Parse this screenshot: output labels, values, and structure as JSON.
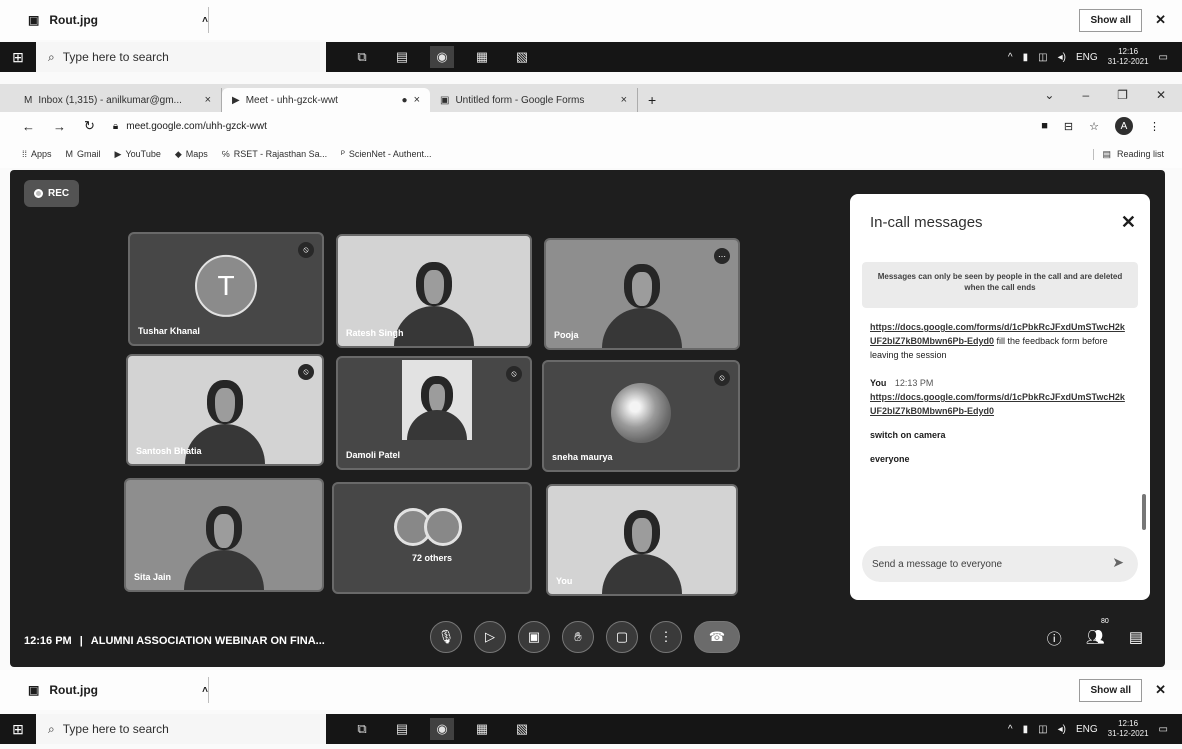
{
  "download_bar": {
    "file_name": "Rout.jpg",
    "show_all": "Show all",
    "close": "✕"
  },
  "taskbar": {
    "search_placeholder": "Type here to search",
    "tray_lang": "ENG",
    "time": "12:16",
    "date": "31-12-2021"
  },
  "browser": {
    "tabs": [
      {
        "title": "Inbox (1,315) - anilkumar@gm...",
        "icon": "gmail-icon"
      },
      {
        "title": "Meet - uhh-gzck-wwt",
        "icon": "meet-icon"
      },
      {
        "title": "Untitled form - Google Forms",
        "icon": "forms-icon"
      }
    ],
    "new_tab": "+",
    "url": "meet.google.com/uhh-gzck-wwt",
    "bookmarks": [
      {
        "label": "Apps",
        "icon": "apps-icon"
      },
      {
        "label": "Gmail",
        "icon": "gmail-icon"
      },
      {
        "label": "YouTube",
        "icon": "youtube-icon"
      },
      {
        "label": "Maps",
        "icon": "maps-icon"
      },
      {
        "label": "RSET - Rajasthan Sa...",
        "icon": "site-icon"
      },
      {
        "label": "ScienNet - Authent...",
        "icon": "site-icon"
      }
    ],
    "reading_list": "Reading list",
    "profile_initial": "A"
  },
  "meet": {
    "rec_label": "REC",
    "participants": [
      {
        "name": "Tushar Khanal",
        "initial": "T",
        "kind": "avatar"
      },
      {
        "name": "Ratesh Singh",
        "kind": "video"
      },
      {
        "name": "Pooja",
        "kind": "video"
      },
      {
        "name": "Santosh Bhatia",
        "kind": "video"
      },
      {
        "name": "Damoli Patel",
        "kind": "video"
      },
      {
        "name": "sneha maurya",
        "kind": "image"
      },
      {
        "name": "Sita Jain",
        "kind": "video"
      },
      {
        "name": "72 others",
        "kind": "others"
      },
      {
        "name": "You",
        "kind": "video"
      }
    ],
    "meeting_time": "12:16 PM",
    "meeting_title": "ALUMNI ASSOCIATION WEBINAR ON FINA...",
    "participant_badge": "80"
  },
  "chat": {
    "title": "In-call messages",
    "notice": "Messages can only be seen by people in the call and are deleted when the call ends",
    "messages": [
      {
        "link": "https://docs.google.com/forms/d/1cPbkRcJFxdUmSTwcH2kUF2bIZ7kB0Mbwn6Pb-Edyd0",
        "text": "fill the feedback form before leaving the session"
      },
      {
        "sender": "You",
        "time": "12:13 PM",
        "link": "https://docs.google.com/forms/d/1cPbkRcJFxdUmSTwcH2kUF2bIZ7kB0Mbwn6Pb-Edyd0"
      },
      {
        "text": "switch on camera"
      },
      {
        "text": "everyone"
      }
    ],
    "input_placeholder": "Send a message to everyone"
  }
}
